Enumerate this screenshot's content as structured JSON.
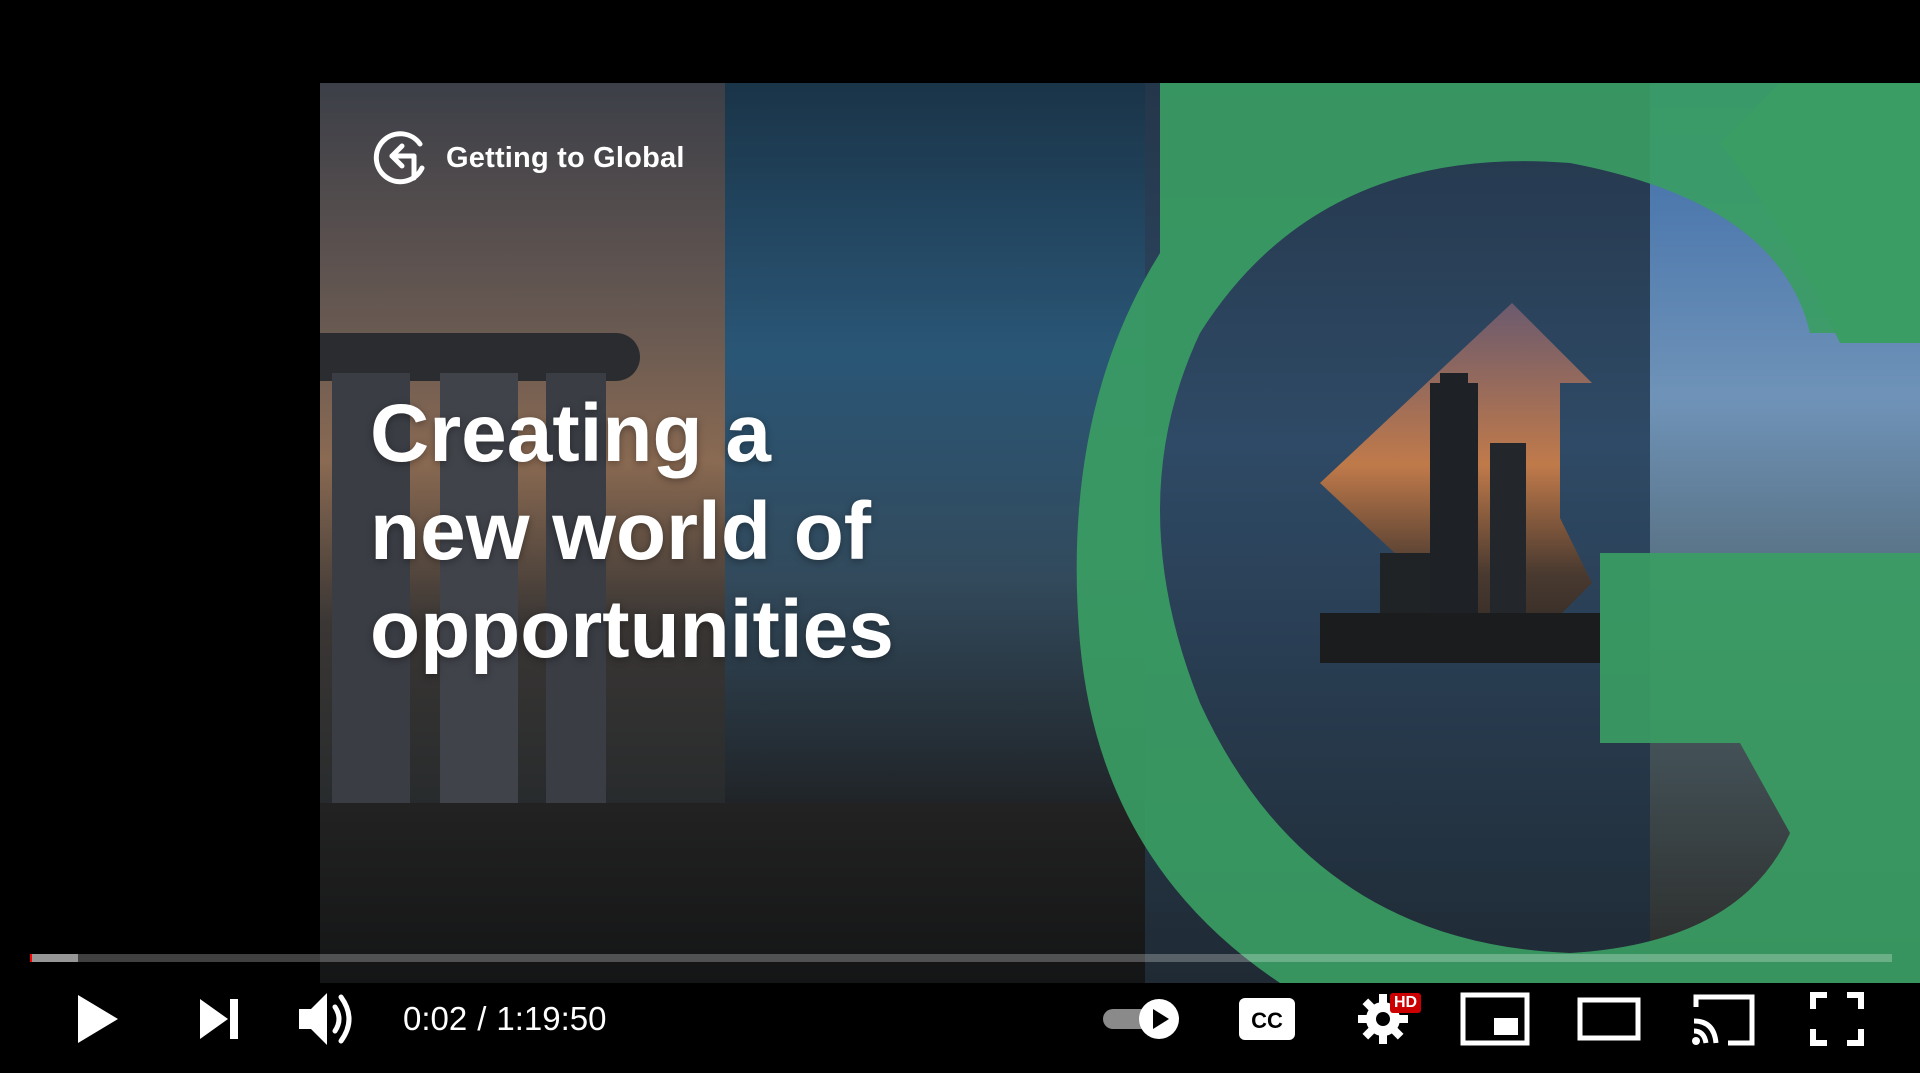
{
  "slide": {
    "brand_name": "Getting to Global",
    "headline_line1": "Creating a",
    "headline_line2": "new world of",
    "headline_line3": "opportunities",
    "accent_color": "#3a9d63"
  },
  "player": {
    "current_time": "0:02",
    "separator": "/",
    "duration": "1:19:50",
    "progress_fraction": 0.0004,
    "buffered_fraction": 0.026,
    "hd_label": "HD",
    "autoplay_on": true,
    "progress_color": "#ff0000"
  },
  "icons": [
    "play-icon",
    "next-icon",
    "volume-icon",
    "autoplay-toggle-icon",
    "captions-icon",
    "settings-icon",
    "miniplayer-icon",
    "theater-icon",
    "cast-icon",
    "fullscreen-icon"
  ]
}
